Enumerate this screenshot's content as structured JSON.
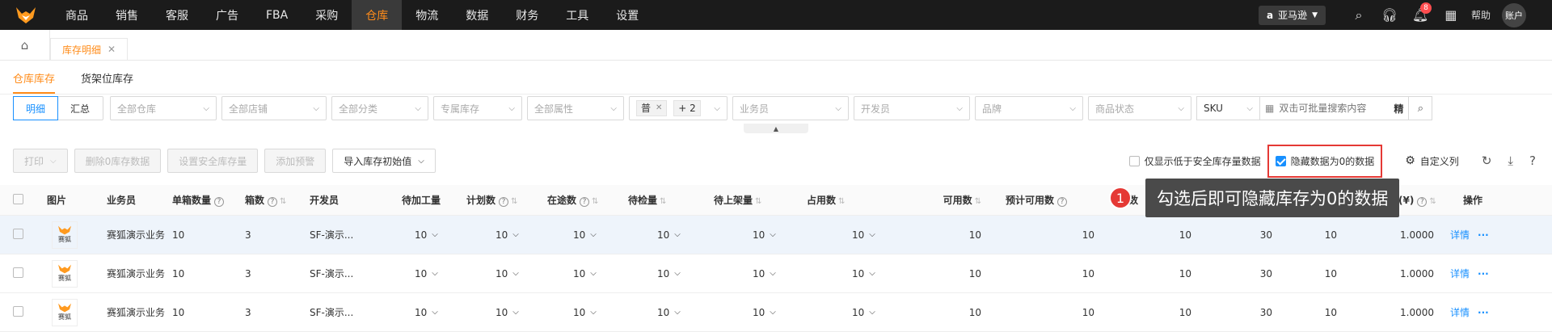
{
  "nav": {
    "items": [
      "商品",
      "销售",
      "客服",
      "广告",
      "FBA",
      "采购",
      "仓库",
      "物流",
      "数据",
      "财务",
      "工具",
      "设置"
    ],
    "active": "仓库",
    "platform": "亚马逊",
    "notification_count": "8",
    "help": "帮助",
    "account": "账户"
  },
  "tabs": {
    "page_tab": "库存明细"
  },
  "subtabs": [
    "仓库库存",
    "货架位库存"
  ],
  "filters": {
    "segment": [
      "明细",
      "汇总"
    ],
    "warehouse": "全部仓库",
    "shop": "全部店铺",
    "category": "全部分类",
    "exclusive": "专属库存",
    "attribute": "全部属性",
    "tag": "普",
    "tag_more": "+ 2",
    "salesperson": "业务员",
    "developer": "开发员",
    "brand": "品牌",
    "status": "商品状态",
    "search_type": "SKU",
    "search_placeholder": "双击可批量搜索内容",
    "precise": "精"
  },
  "toolbar": {
    "print": "打印",
    "delete_zero": "删除0库存数据",
    "set_safety": "设置安全库存量",
    "add_alert": "添加预警",
    "import_initial": "导入库存初始值",
    "only_below_safety": "仅显示低于安全库存量数据",
    "hide_zero": "隐藏数据为0的数据",
    "custom_columns": "自定义列"
  },
  "table": {
    "headers": {
      "image": "图片",
      "salesperson": "业务员",
      "box_qty": "单箱数量",
      "boxes": "箱数",
      "developer": "开发员",
      "pending_process": "待加工量",
      "planned": "计划数",
      "in_transit": "在途数",
      "pending_inspect": "待检量",
      "pending_shelf": "待上架量",
      "occupied": "占用数",
      "available": "可用数",
      "expected": "预计可用数",
      "qty": "数",
      "unit_price": "单价(¥)",
      "ops": "操作"
    },
    "thumb_label": "赛狐",
    "rows": [
      {
        "salesperson": "赛狐演示业务",
        "box_qty": "10",
        "boxes": "3",
        "developer": "SF-演示...",
        "pending_process": "10",
        "planned": "10",
        "in_transit": "10",
        "pending_inspect": "10",
        "pending_shelf": "10",
        "occupied": "10",
        "available": "10",
        "expected": "10",
        "c13": "10",
        "c14": "30",
        "c15": "10",
        "unit_price": "1.0000",
        "detail": "详情",
        "more": "···"
      },
      {
        "salesperson": "赛狐演示业务",
        "box_qty": "10",
        "boxes": "3",
        "developer": "SF-演示...",
        "pending_process": "10",
        "planned": "10",
        "in_transit": "10",
        "pending_inspect": "10",
        "pending_shelf": "10",
        "occupied": "10",
        "available": "10",
        "expected": "10",
        "c13": "10",
        "c14": "30",
        "c15": "10",
        "unit_price": "1.0000",
        "detail": "详情",
        "more": "···"
      },
      {
        "salesperson": "赛狐演示业务",
        "box_qty": "10",
        "boxes": "3",
        "developer": "SF-演示...",
        "pending_process": "10",
        "planned": "10",
        "in_transit": "10",
        "pending_inspect": "10",
        "pending_shelf": "10",
        "occupied": "10",
        "available": "10",
        "expected": "10",
        "c13": "10",
        "c14": "30",
        "c15": "10",
        "unit_price": "1.0000",
        "detail": "详情",
        "more": "···"
      }
    ]
  },
  "annotation": {
    "marker": "1",
    "text": "勾选后即可隐藏库存为0的数据"
  },
  "colors": {
    "accent": "#ff8c1a",
    "primary": "#1890ff",
    "highlight": "#e53935"
  }
}
